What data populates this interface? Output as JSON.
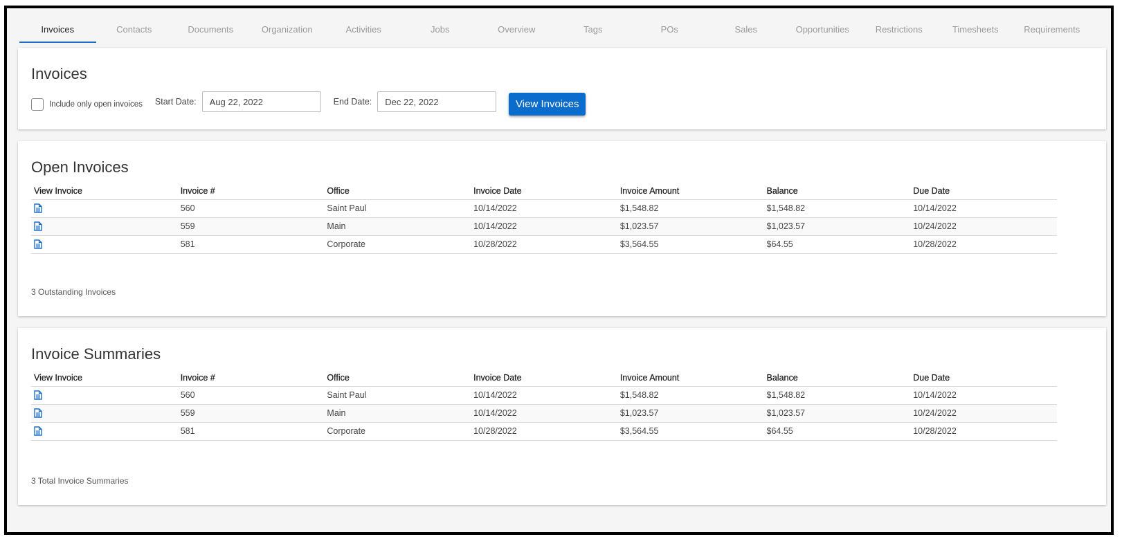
{
  "tabs": [
    {
      "label": "Invoices",
      "active": true
    },
    {
      "label": "Contacts"
    },
    {
      "label": "Documents"
    },
    {
      "label": "Organization"
    },
    {
      "label": "Activities"
    },
    {
      "label": "Jobs"
    },
    {
      "label": "Overview"
    },
    {
      "label": "Tags"
    },
    {
      "label": "POs"
    },
    {
      "label": "Sales"
    },
    {
      "label": "Opportunities"
    },
    {
      "label": "Restrictions"
    },
    {
      "label": "Timesheets"
    },
    {
      "label": "Requirements"
    }
  ],
  "filter_card": {
    "title": "Invoices",
    "checkbox_label": "Include only open invoices",
    "start_label": "Start Date:",
    "start_value": "Aug 22, 2022",
    "end_label": "End Date:",
    "end_value": "Dec 22, 2022",
    "button_label": "View Invoices"
  },
  "columns": [
    "View Invoice",
    "Invoice #",
    "Office",
    "Invoice Date",
    "Invoice Amount",
    "Balance",
    "Due Date"
  ],
  "open_invoices": {
    "title": "Open Invoices",
    "rows": [
      {
        "number": "560",
        "office": "Saint Paul",
        "date": "10/14/2022",
        "amount": "$1,548.82",
        "balance": "$1,548.82",
        "due": "10/14/2022"
      },
      {
        "number": "559",
        "office": "Main",
        "date": "10/14/2022",
        "amount": "$1,023.57",
        "balance": "$1,023.57",
        "due": "10/24/2022"
      },
      {
        "number": "581",
        "office": "Corporate",
        "date": "10/28/2022",
        "amount": "$3,564.55",
        "balance": "$64.55",
        "due": "10/28/2022"
      }
    ],
    "footer": "3 Outstanding Invoices"
  },
  "summaries": {
    "title": "Invoice Summaries",
    "rows": [
      {
        "number": "560",
        "office": "Saint Paul",
        "date": "10/14/2022",
        "amount": "$1,548.82",
        "balance": "$1,548.82",
        "due": "10/14/2022"
      },
      {
        "number": "559",
        "office": "Main",
        "date": "10/14/2022",
        "amount": "$1,023.57",
        "balance": "$1,023.57",
        "due": "10/24/2022"
      },
      {
        "number": "581",
        "office": "Corporate",
        "date": "10/28/2022",
        "amount": "$3,564.55",
        "balance": "$64.55",
        "due": "10/28/2022"
      }
    ],
    "footer": "3 Total Invoice Summaries"
  },
  "colors": {
    "accent": "#0a6ccc",
    "icon": "#1e6fc7"
  },
  "icons": {
    "view_invoice": "document-icon"
  }
}
